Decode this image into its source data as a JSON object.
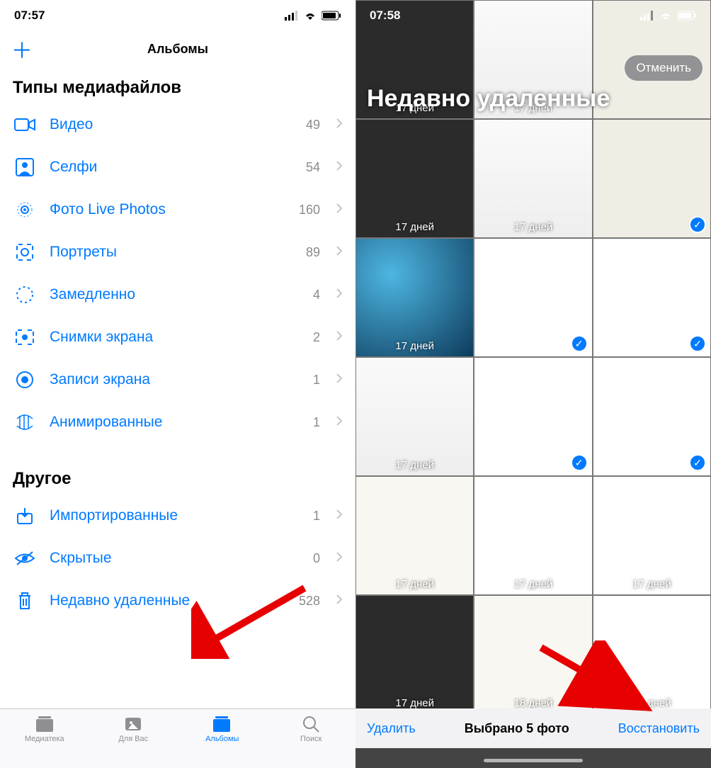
{
  "left": {
    "status_time": "07:57",
    "header_title": "Альбомы",
    "section_media": "Типы медиафайлов",
    "rows_media": [
      {
        "icon": "video",
        "label": "Видео",
        "count": "49"
      },
      {
        "icon": "selfie",
        "label": "Селфи",
        "count": "54"
      },
      {
        "icon": "live",
        "label": "Фото Live Photos",
        "count": "160"
      },
      {
        "icon": "portrait",
        "label": "Портреты",
        "count": "89"
      },
      {
        "icon": "slowmo",
        "label": "Замедленно",
        "count": "4"
      },
      {
        "icon": "screenshot",
        "label": "Снимки экрана",
        "count": "2"
      },
      {
        "icon": "screenrec",
        "label": "Записи экрана",
        "count": "1"
      },
      {
        "icon": "animated",
        "label": "Анимированные",
        "count": "1"
      }
    ],
    "section_other": "Другое",
    "rows_other": [
      {
        "icon": "import",
        "label": "Импортированные",
        "count": "1"
      },
      {
        "icon": "hidden",
        "label": "Скрытые",
        "count": "0"
      },
      {
        "icon": "trash",
        "label": "Недавно удаленные",
        "count": "528"
      }
    ],
    "tabs": [
      {
        "label": "Медиатека"
      },
      {
        "label": "Для Вас"
      },
      {
        "label": "Альбомы"
      },
      {
        "label": "Поиск"
      }
    ]
  },
  "right": {
    "status_time": "07:58",
    "title": "Недавно удаленные",
    "cancel": "Отменить",
    "days_label": "17 дней",
    "days_label_18": "18 дней",
    "delete": "Удалить",
    "selected": "Выбрано 5 фото",
    "restore": "Восстановить",
    "cells": [
      {
        "days_key": "days_label",
        "checked": false,
        "cls": "thumb-dark"
      },
      {
        "days_key": "days_label",
        "checked": false,
        "cls": "thumb-doc"
      },
      {
        "days_key": "",
        "checked": false,
        "cls": "thumb-card"
      },
      {
        "days_key": "days_label",
        "checked": false,
        "cls": "thumb-dark"
      },
      {
        "days_key": "days_label",
        "checked": false,
        "cls": "thumb-doc"
      },
      {
        "days_key": "",
        "checked": true,
        "cls": "thumb-card"
      },
      {
        "days_key": "days_label",
        "checked": false,
        "cls": "thumb-blue"
      },
      {
        "days_key": "",
        "checked": true,
        "cls": "thumb-app"
      },
      {
        "days_key": "",
        "checked": true,
        "cls": "thumb-app"
      },
      {
        "days_key": "days_label",
        "checked": false,
        "cls": "thumb-doc"
      },
      {
        "days_key": "",
        "checked": true,
        "cls": "thumb-app"
      },
      {
        "days_key": "",
        "checked": true,
        "cls": "thumb-app"
      },
      {
        "days_key": "days_label",
        "checked": false,
        "cls": "thumb-text"
      },
      {
        "days_key": "days_label",
        "checked": false,
        "cls": "thumb-app"
      },
      {
        "days_key": "days_label",
        "checked": false,
        "cls": "thumb-app"
      },
      {
        "days_key": "days_label",
        "checked": false,
        "cls": "thumb-dark"
      },
      {
        "days_key": "days_label_18",
        "checked": false,
        "cls": "thumb-text"
      },
      {
        "days_key": "days_label_18",
        "checked": false,
        "cls": "thumb-app"
      }
    ]
  }
}
